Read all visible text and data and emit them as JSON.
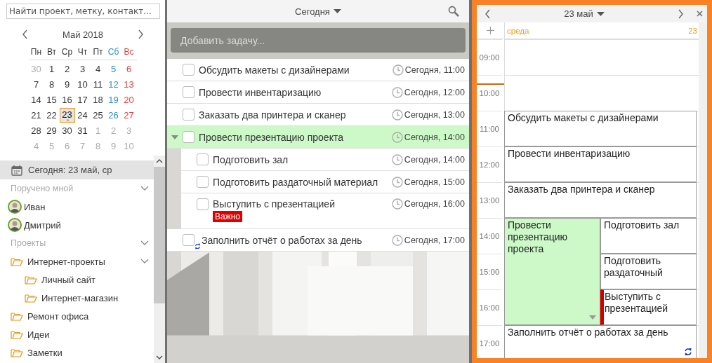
{
  "sidebar": {
    "search": {
      "placeholder": "Найти проект, метку, контакт..."
    },
    "mini_calendar": {
      "title": "Май 2018",
      "weekdays": [
        {
          "label": "Пн",
          "kind": "weekday"
        },
        {
          "label": "Вт",
          "kind": "weekday"
        },
        {
          "label": "Ср",
          "kind": "weekday"
        },
        {
          "label": "Чт",
          "kind": "weekday"
        },
        {
          "label": "Пт",
          "kind": "weekday"
        },
        {
          "label": "Сб",
          "kind": "saturday"
        },
        {
          "label": "Вс",
          "kind": "sunday"
        }
      ],
      "weeks": [
        [
          {
            "day": "30",
            "other_month": true,
            "selected": false
          },
          {
            "day": "1",
            "other_month": false,
            "selected": false
          },
          {
            "day": "2",
            "other_month": false,
            "selected": false
          },
          {
            "day": "3",
            "other_month": false,
            "selected": false
          },
          {
            "day": "4",
            "other_month": false,
            "selected": false
          },
          {
            "day": "5",
            "other_month": false,
            "selected": false
          },
          {
            "day": "6",
            "other_month": false,
            "selected": false
          }
        ],
        [
          {
            "day": "7",
            "other_month": false,
            "selected": false
          },
          {
            "day": "8",
            "other_month": false,
            "selected": false
          },
          {
            "day": "9",
            "other_month": false,
            "selected": false
          },
          {
            "day": "10",
            "other_month": false,
            "selected": false
          },
          {
            "day": "11",
            "other_month": false,
            "selected": false
          },
          {
            "day": "12",
            "other_month": false,
            "selected": false
          },
          {
            "day": "13",
            "other_month": false,
            "selected": false
          }
        ],
        [
          {
            "day": "14",
            "other_month": false,
            "selected": false
          },
          {
            "day": "15",
            "other_month": false,
            "selected": false
          },
          {
            "day": "16",
            "other_month": false,
            "selected": false
          },
          {
            "day": "17",
            "other_month": false,
            "selected": false
          },
          {
            "day": "18",
            "other_month": false,
            "selected": false
          },
          {
            "day": "19",
            "other_month": false,
            "selected": false
          },
          {
            "day": "20",
            "other_month": false,
            "selected": false
          }
        ],
        [
          {
            "day": "21",
            "other_month": false,
            "selected": false
          },
          {
            "day": "22",
            "other_month": false,
            "selected": false
          },
          {
            "day": "23",
            "other_month": false,
            "selected": true
          },
          {
            "day": "24",
            "other_month": false,
            "selected": false
          },
          {
            "day": "25",
            "other_month": false,
            "selected": false
          },
          {
            "day": "26",
            "other_month": false,
            "selected": false
          },
          {
            "day": "27",
            "other_month": false,
            "selected": false
          }
        ],
        [
          {
            "day": "28",
            "other_month": false,
            "selected": false
          },
          {
            "day": "29",
            "other_month": false,
            "selected": false
          },
          {
            "day": "30",
            "other_month": false,
            "selected": false
          },
          {
            "day": "31",
            "other_month": false,
            "selected": false
          },
          {
            "day": "1",
            "other_month": true,
            "selected": false
          },
          {
            "day": "2",
            "other_month": true,
            "selected": false
          },
          {
            "day": "3",
            "other_month": true,
            "selected": false
          }
        ],
        [
          {
            "day": "4",
            "other_month": true,
            "selected": false
          },
          {
            "day": "5",
            "other_month": true,
            "selected": false
          },
          {
            "day": "6",
            "other_month": true,
            "selected": false
          },
          {
            "day": "7",
            "other_month": true,
            "selected": false
          },
          {
            "day": "8",
            "other_month": true,
            "selected": false
          },
          {
            "day": "9",
            "other_month": true,
            "selected": false
          },
          {
            "day": "10",
            "other_month": true,
            "selected": false
          }
        ]
      ]
    },
    "today_item": {
      "label": "Сегодня: 23 май, ср",
      "selected": true
    },
    "sections": [
      {
        "title": "Поручено мной",
        "expanded": true,
        "items": [
          {
            "kind": "person",
            "label": "Иван"
          },
          {
            "kind": "person",
            "label": "Дмитрий"
          }
        ]
      },
      {
        "title": "Проекты",
        "expanded": true,
        "items": [
          {
            "kind": "folder",
            "label": "Интернет-проекты",
            "expanded": true,
            "children": [
              {
                "kind": "folder",
                "label": "Личный сайт"
              },
              {
                "kind": "folder",
                "label": "Интернет-магазин"
              }
            ]
          },
          {
            "kind": "folder",
            "label": "Ремонт офиса"
          },
          {
            "kind": "folder",
            "label": "Идеи"
          },
          {
            "kind": "folder",
            "label": "Заметки"
          }
        ]
      }
    ]
  },
  "task_list": {
    "title": "Сегодня",
    "add_task": {
      "placeholder": "Добавить задачу..."
    },
    "tasks": [
      {
        "title": "Обсудить макеты с дизайнерами",
        "time": "Сегодня, 11:00",
        "checked": false,
        "selected": false,
        "recurring": false
      },
      {
        "title": "Провести инвентаризацию",
        "time": "Сегодня, 12:00",
        "checked": false,
        "selected": false,
        "recurring": false
      },
      {
        "title": "Заказать два принтера и сканер",
        "time": "Сегодня, 13:00",
        "checked": false,
        "selected": false,
        "recurring": false
      },
      {
        "title": "Провести презентацию проекта",
        "time": "Сегодня, 14:00",
        "checked": false,
        "selected": true,
        "recurring": false,
        "expanded": true,
        "children": [
          {
            "title": "Подготовить зал",
            "time": "Сегодня, 14:00",
            "checked": false,
            "selected": false,
            "recurring": false
          },
          {
            "title": "Подготовить раздаточный материал",
            "time": "Сегодня, 15:00",
            "checked": false,
            "selected": false,
            "recurring": false
          },
          {
            "title": "Выступить с презентацией",
            "time": "Сегодня, 16:00",
            "checked": false,
            "selected": false,
            "recurring": false,
            "tag": "Важно"
          }
        ]
      },
      {
        "title": "Заполнить отчёт о работах за день",
        "time": "Сегодня, 17:00",
        "checked": false,
        "selected": false,
        "recurring": true
      }
    ]
  },
  "day_view": {
    "title": "23 май",
    "weekday": "среда",
    "date": "23",
    "hours": [
      {
        "time": "09:00"
      },
      {
        "time": "10:00",
        "now": {
          "level": 0.25
        }
      },
      {
        "time": "11:00",
        "event": {
          "title": "Обсудить макеты с дизайнерами",
          "selected": false,
          "recurring": false
        }
      },
      {
        "time": "12:00",
        "event": {
          "title": "Провести инвентаризацию",
          "selected": false,
          "recurring": false
        }
      },
      {
        "time": "13:00",
        "event": {
          "title": "Заказать два принтера и сканер",
          "selected": false,
          "recurring": false
        }
      },
      {
        "time": "14:00",
        "event": {
          "title": "Провести презентацию проекта",
          "selected": true,
          "recurring": false,
          "expanded": true,
          "children": [
            {
              "title": "Подготовить зал",
              "important": false
            },
            {
              "title": "Подготовить раздаточный",
              "important": false
            },
            {
              "title": "Выступить с презентацией",
              "important": true
            }
          ]
        }
      },
      {
        "time": "15:00"
      },
      {
        "time": "16:00"
      },
      {
        "time": "17:00",
        "event": {
          "title": "Заполнить отчёт о работах за день",
          "selected": false,
          "recurring": true
        }
      }
    ]
  }
}
